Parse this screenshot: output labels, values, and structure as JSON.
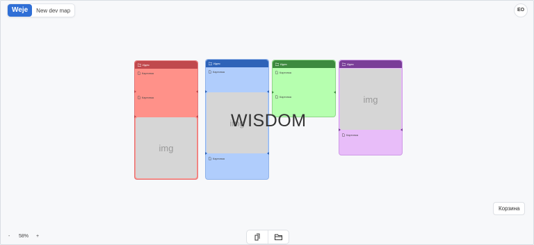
{
  "app": {
    "logo": "Weje",
    "map_title": "New dev map",
    "user_initials": "EO"
  },
  "zoom": {
    "minus": "-",
    "level": "58%",
    "plus": "+"
  },
  "basket_label": "Корзина",
  "watermark": "WISDOM",
  "bottom_toolbar": {
    "items": [
      "document-icon",
      "folder-icon"
    ]
  },
  "colors": {
    "red": "#c0494d",
    "red_body": "#ff9189",
    "blue": "#2e63b8",
    "blue_body": "#b0cdfc",
    "green": "#3d8a3f",
    "green_body": "#b6ffaf",
    "purple": "#7a3d98",
    "purple_body": "#e8bdf9"
  },
  "cards": [
    {
      "id": "red",
      "title": "Идея",
      "rows": [
        "Картинка",
        "Картинка"
      ],
      "image": "img"
    },
    {
      "id": "blue",
      "title": "Идея",
      "rows": [
        "Картинка",
        "Картинка"
      ],
      "image": "img"
    },
    {
      "id": "green",
      "title": "Идея",
      "rows": [
        "Картинка",
        "Картинка"
      ]
    },
    {
      "id": "purple",
      "title": "Идея",
      "rows": [
        "Картинка"
      ],
      "image": "img"
    }
  ]
}
